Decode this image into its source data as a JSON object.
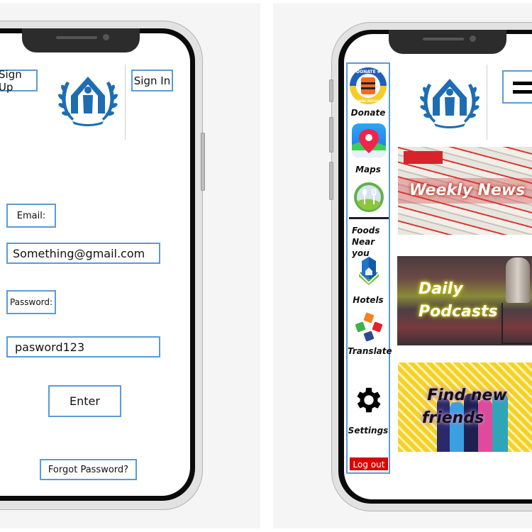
{
  "login_screen": {
    "sign_up_label": "Sign Up",
    "sign_in_label": "Sign In",
    "logo": "unhcr-emblem",
    "email_label": "Email:",
    "email_value": "Something@gmail.com",
    "password_label": "Password:",
    "password_value": "pasword123",
    "enter_label": "Enter",
    "forgot_password_label": "Forgot Password?"
  },
  "home_screen": {
    "logo": "unhcr-emblem",
    "menu_icon": "hamburger-menu-icon",
    "sidebar": {
      "items": [
        {
          "label": "Donate",
          "icon": "donate-ukraine-refugees-icon",
          "icon_text_top": "DONATE 4",
          "icon_text_bottom": "UKRAINE REFUGEES"
        },
        {
          "label": "Maps",
          "icon": "map-pin-icon"
        },
        {
          "label": "Foods\nNear you",
          "label_line1": "Foods",
          "label_line2": "Near you",
          "icon": "fork-spoon-icon"
        },
        {
          "label": "Hotels",
          "icon": "hotel-building-icon"
        },
        {
          "label": "Translate",
          "icon": "translate-chat-icon"
        },
        {
          "label": "Settings",
          "icon": "gear-icon"
        }
      ],
      "logout_label": "Log out"
    },
    "tiles": [
      {
        "title": "Weekly News",
        "image": "newspapers"
      },
      {
        "title_line1": "Daily",
        "title_line2": "Podcasts",
        "image": "microphone"
      },
      {
        "title_line1": "Find new",
        "title_line2": "friends",
        "image": "group-of-friends"
      }
    ]
  },
  "colors": {
    "box_border": "#5b9bd5",
    "unhcr_blue": "#1d6db3",
    "logout_red": "#e00000"
  }
}
